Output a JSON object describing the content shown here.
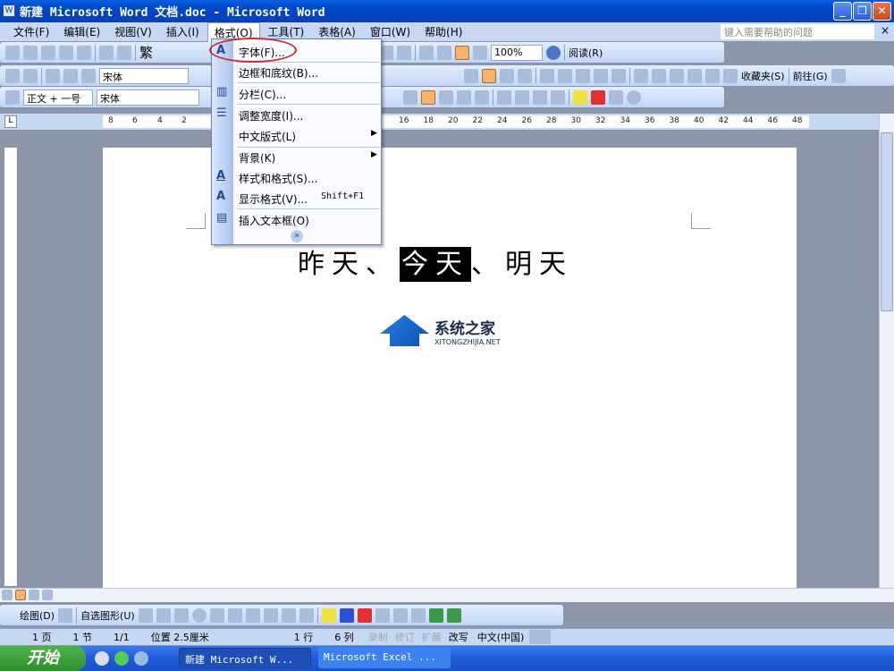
{
  "window": {
    "title": "新建 Microsoft Word 文档.doc - Microsoft Word",
    "minimize": "_",
    "restore": "❐",
    "close": "✕"
  },
  "menubar": {
    "items": [
      "文件(F)",
      "编辑(E)",
      "视图(V)",
      "插入(I)",
      "格式(O)",
      "工具(T)",
      "表格(A)",
      "窗口(W)",
      "帮助(H)"
    ],
    "help_placeholder": "键入需要帮助的问题",
    "help_close": "×"
  },
  "toolbar1": {
    "trad": "繁",
    "zoom": "100%",
    "read": "阅读(R)"
  },
  "toolbar2": {
    "font": "宋体",
    "favorites": "收藏夹(S)",
    "goto": "前往(G)"
  },
  "toolbar3": {
    "style": "正文 + 一号",
    "font": "宋体"
  },
  "ruler": {
    "left_ticks": [
      "8",
      "6",
      "4",
      "2"
    ],
    "right_ticks": [
      "16",
      "18",
      "20",
      "22",
      "24",
      "26",
      "28",
      "30",
      "32",
      "34",
      "36",
      "38",
      "40",
      "42",
      "44",
      "46",
      "48"
    ]
  },
  "format_menu": {
    "items": [
      {
        "label": "字体(F)...",
        "icon": "A"
      },
      {
        "label": "边框和底纹(B)..."
      },
      {
        "label": "分栏(C)...",
        "icon": "▥"
      },
      {
        "label": "调整宽度(I)...",
        "icon": "☰"
      },
      {
        "label": "中文版式(L)",
        "submenu": "▶"
      },
      {
        "label": "背景(K)",
        "submenu": "▶"
      },
      {
        "label": "样式和格式(S)...",
        "icon": "A"
      },
      {
        "label": "显示格式(V)...",
        "shortcut": "Shift+F1",
        "icon": "A"
      },
      {
        "label": "插入文本框(O)",
        "icon": "▤"
      }
    ],
    "expand": "»"
  },
  "document": {
    "before": "昨天、",
    "selected": "今天",
    "after": "、明天"
  },
  "watermark": {
    "name": "系统之家",
    "url": "XITONGZHIJIA.NET"
  },
  "drawbar": {
    "draw": "绘图(D)",
    "autoshapes": "自选图形(U)"
  },
  "status": {
    "page": "1 页",
    "section": "1 节",
    "pages": "1/1",
    "position": "位置 2.5厘米",
    "line": "1 行",
    "col": "6 列",
    "rec": "录制",
    "trk": "修订",
    "ext": "扩展",
    "ovr": "改写",
    "lang": "中文(中国)"
  },
  "taskbar": {
    "start": "开始",
    "tasks": [
      "新建 Microsoft W...",
      "Microsoft Excel ..."
    ]
  }
}
